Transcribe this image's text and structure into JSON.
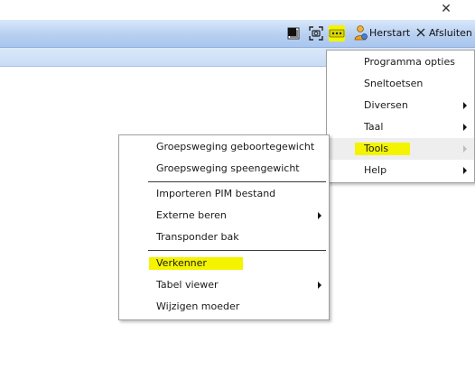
{
  "window": {
    "close_glyph": "✕"
  },
  "toolbar": {
    "icons": [
      "fullscreen-icon",
      "screenshot-icon",
      "more-options-icon"
    ],
    "herstart_label": "Herstart",
    "afsluiten_label": "Afsluiten",
    "highlight_color": "#f4f400"
  },
  "main_menu": {
    "items": [
      {
        "label": "Programma opties",
        "submenu": false
      },
      {
        "label": "Sneltoetsen",
        "submenu": false
      },
      {
        "label": "Diversen",
        "submenu": true
      },
      {
        "label": "Taal",
        "submenu": true
      },
      {
        "label": "Tools",
        "submenu": true,
        "active": true,
        "highlighted": true
      },
      {
        "label": "Help",
        "submenu": true
      }
    ]
  },
  "tools_menu": {
    "items": [
      {
        "label": "Groepsweging geboortegewicht",
        "submenu": false
      },
      {
        "label": "Groepsweging speengewicht",
        "submenu": false
      },
      {
        "label": "Importeren PIM bestand",
        "submenu": false
      },
      {
        "label": "Externe beren",
        "submenu": true
      },
      {
        "label": "Transponder bak",
        "submenu": false
      },
      {
        "label": "Verkenner",
        "submenu": false,
        "highlighted": true
      },
      {
        "label": "Tabel viewer",
        "submenu": true
      },
      {
        "label": "Wijzigen moeder",
        "submenu": false
      }
    ]
  }
}
